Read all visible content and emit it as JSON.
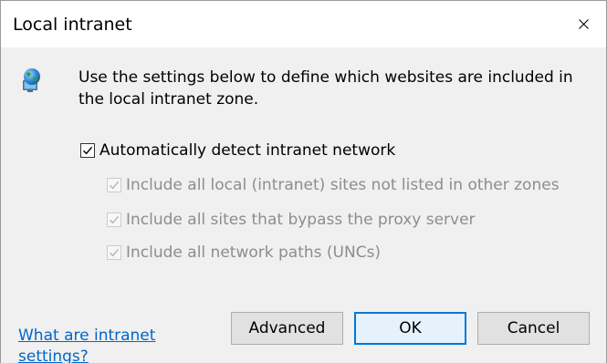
{
  "window": {
    "title": "Local intranet",
    "close_icon": "close-icon"
  },
  "description": "Use the settings below to define which websites are included in the local intranet zone.",
  "icon": "intranet-globe-icon",
  "options": {
    "auto_detect": {
      "label": "Automatically detect intranet network",
      "checked": true,
      "enabled": true
    },
    "local_sites": {
      "label": "Include all local (intranet) sites not listed in other zones",
      "checked": true,
      "enabled": false
    },
    "bypass_proxy": {
      "label": "Include all sites that bypass the proxy server",
      "checked": true,
      "enabled": false
    },
    "network_paths": {
      "label": "Include all network paths (UNCs)",
      "checked": true,
      "enabled": false
    }
  },
  "help_link": "What are intranet settings?",
  "buttons": {
    "advanced": "Advanced",
    "ok": "OK",
    "cancel": "Cancel"
  },
  "colors": {
    "link": "#0066cc",
    "default_button_border": "#0078d7",
    "disabled_text": "#8d8d8d"
  }
}
